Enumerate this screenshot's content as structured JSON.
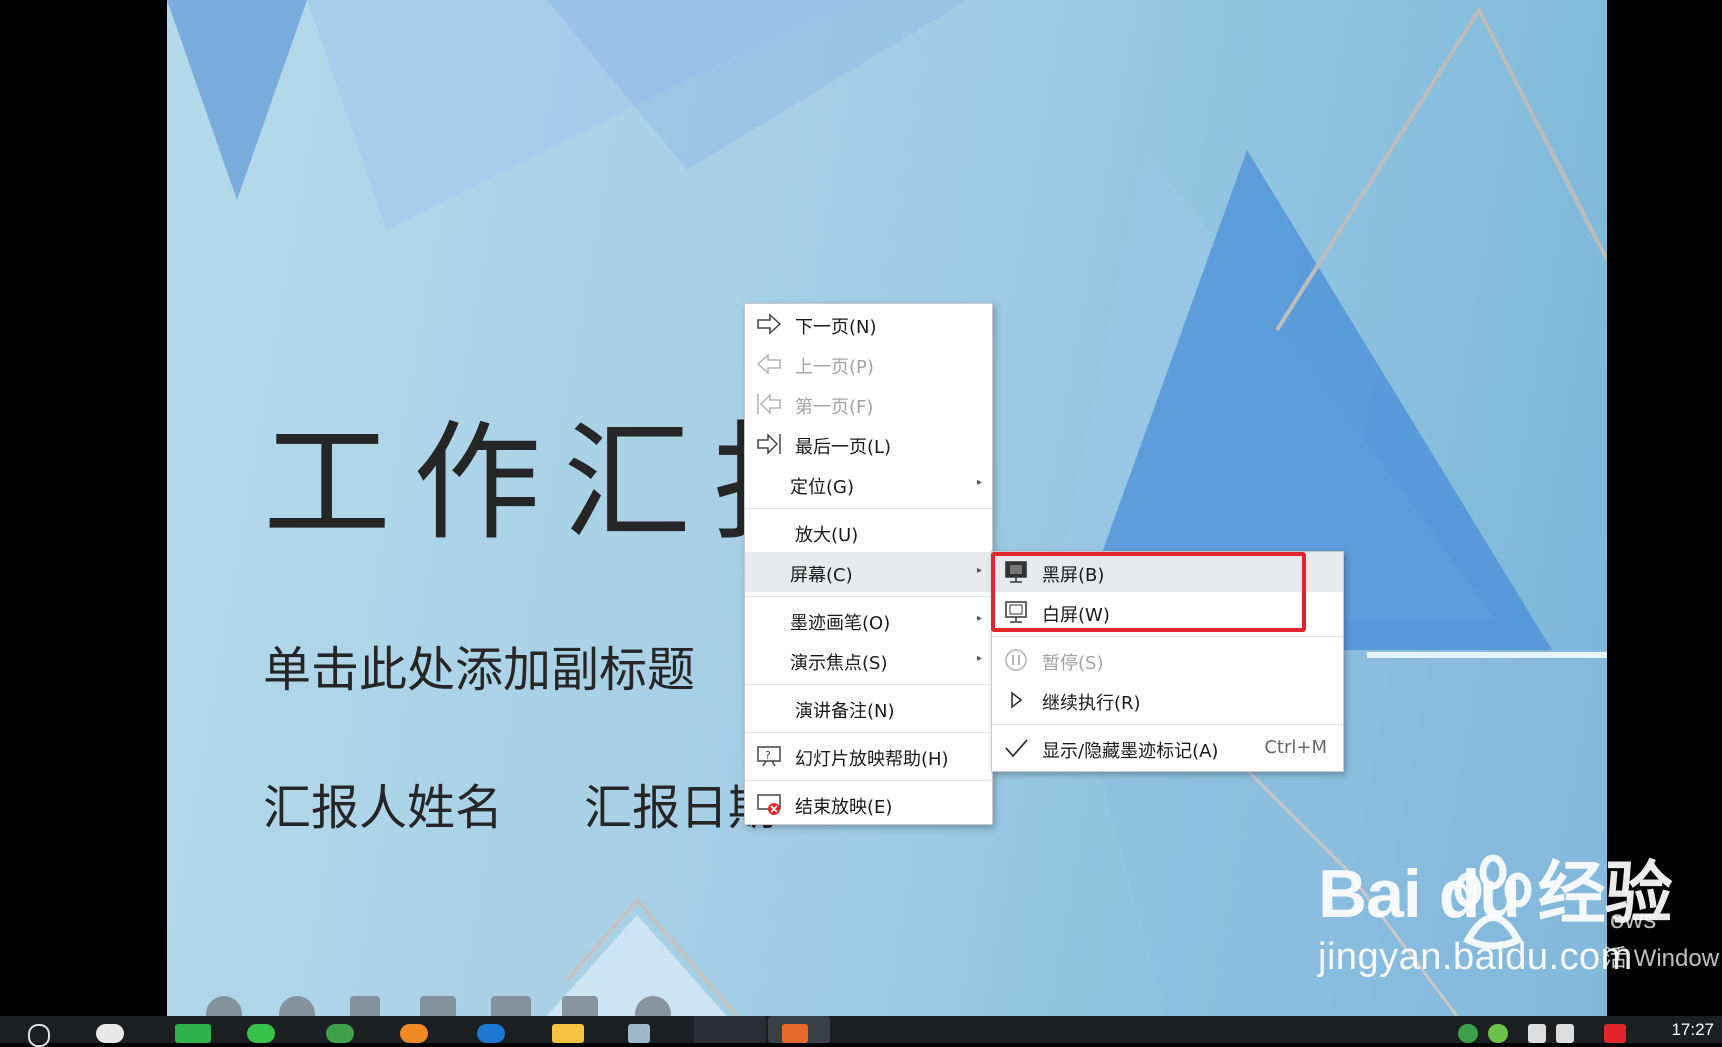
{
  "slide": {
    "title": "工作汇报",
    "subtitle": "单击此处添加副标题",
    "presenter": "汇报人姓名",
    "date": "汇报日期"
  },
  "context_menu": {
    "items": [
      {
        "label": "下一页(N)",
        "icon": "arrow-right-icon",
        "enabled": true
      },
      {
        "label": "上一页(P)",
        "icon": "arrow-left-icon",
        "enabled": false
      },
      {
        "label": "第一页(F)",
        "icon": "first-page-icon",
        "enabled": false
      },
      {
        "label": "最后一页(L)",
        "icon": "last-page-icon",
        "enabled": true
      },
      {
        "label": "定位(G)",
        "submenu": true
      },
      {
        "label": "放大(U)"
      },
      {
        "label": "屏幕(C)",
        "submenu": true,
        "highlighted": true
      },
      {
        "label": "墨迹画笔(O)",
        "submenu": true
      },
      {
        "label": "演示焦点(S)",
        "submenu": true
      },
      {
        "label": "演讲备注(N)"
      },
      {
        "label": "幻灯片放映帮助(H)",
        "icon": "help-icon"
      },
      {
        "label": "结束放映(E)",
        "icon": "end-show-icon"
      }
    ],
    "screen_submenu": [
      {
        "label": "黑屏(B)",
        "icon": "black-screen-icon",
        "highlighted": true
      },
      {
        "label": "白屏(W)",
        "icon": "white-screen-icon"
      },
      {
        "label": "暂停(S)",
        "icon": "pause-icon",
        "enabled": false
      },
      {
        "label": "继续执行(R)",
        "icon": "play-icon"
      },
      {
        "label": "显示/隐藏墨迹标记(A)",
        "icon": "check-icon",
        "shortcut": "Ctrl+M"
      }
    ]
  },
  "watermark": {
    "logo": "Bai du 经验",
    "url": "jingyan.baidu.com",
    "activate_line1": "ows",
    "activate_line2": "活 Window"
  },
  "taskbar": {
    "clock": "17:27"
  },
  "colors": {
    "highlight_box": "#e3262d",
    "menu_highlight": "#e7e9ec",
    "disabled_text": "#a3a3a3"
  }
}
